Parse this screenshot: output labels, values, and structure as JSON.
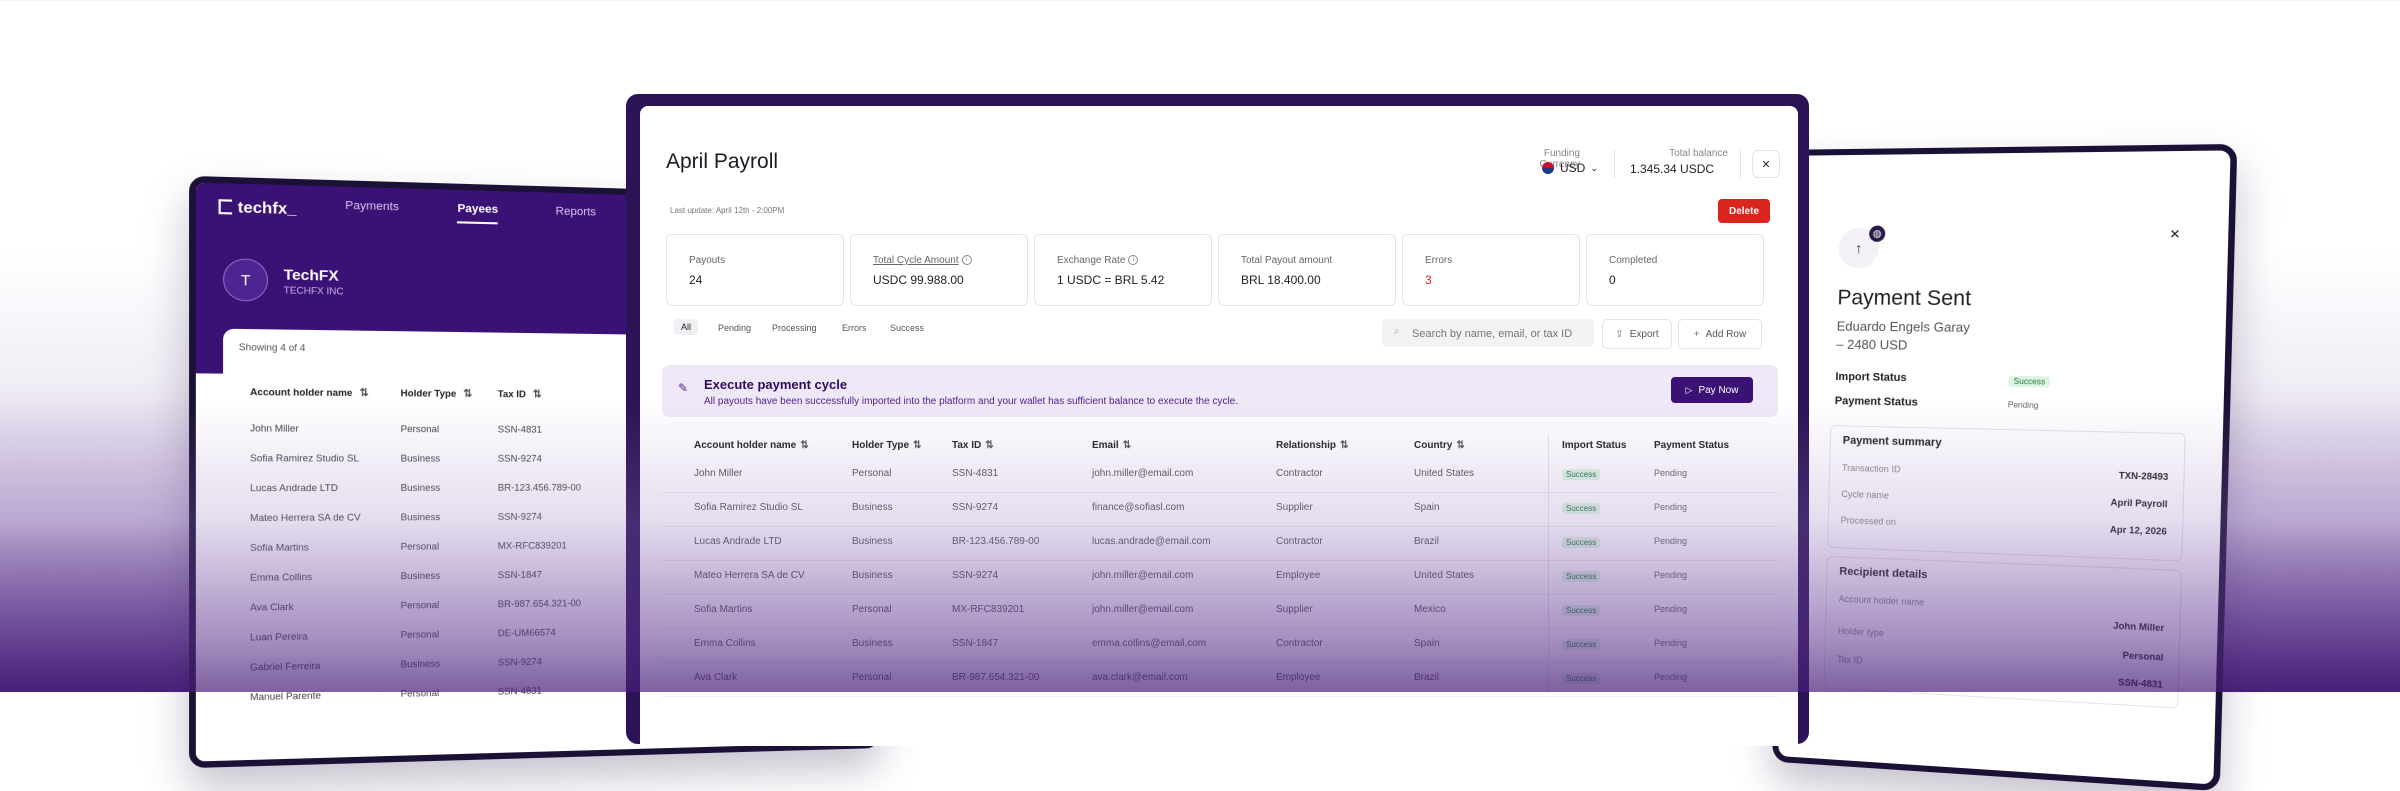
{
  "payees_window": {
    "brand": "techfx_",
    "nav": [
      "Payments",
      "Payees",
      "Reports"
    ],
    "org_initial": "T",
    "org_name": "TechFX",
    "org_sub": "TECHFX INC",
    "showing": "Showing 4 of 4",
    "columns": [
      "Account holder name",
      "Holder Type",
      "Tax ID"
    ],
    "rows": [
      [
        "John Miller",
        "Personal",
        "SSN-4831"
      ],
      [
        "Sofia Ramirez Studio SL",
        "Business",
        "SSN-9274"
      ],
      [
        "Lucas Andrade LTD",
        "Business",
        "BR-123.456.789-00"
      ],
      [
        "Mateo Herrera SA de CV",
        "Business",
        "SSN-9274"
      ],
      [
        "Sofia Martins",
        "Personal",
        "MX-RFC839201"
      ],
      [
        "Emma Collins",
        "Business",
        "SSN-1847"
      ],
      [
        "Ava Clark",
        "Personal",
        "BR-987.654.321-00"
      ],
      [
        "Luan Pereira",
        "Personal",
        "DE-UM66574"
      ],
      [
        "Gabriel Ferreira",
        "Business",
        "SSN-9274"
      ],
      [
        "Manuel Parente",
        "Personal",
        "SSN-4831"
      ]
    ]
  },
  "payment_sent": {
    "title": "Payment Sent",
    "payee": "Eduardo Engels Garay",
    "amount": "– 2480 USD",
    "import_status_label": "Import Status",
    "import_status": "Success",
    "payment_status_label": "Payment Status",
    "payment_status": "Pending",
    "summary_title": "Payment summary",
    "summary": [
      {
        "k": "Transaction ID",
        "v": "TXN-28493"
      },
      {
        "k": "Cycle name",
        "v": "April Payroll"
      },
      {
        "k": "Processed on",
        "v": "Apr 12, 2026"
      }
    ],
    "recipient_title": "Recipient details",
    "recipient": [
      {
        "k": "Account holder name",
        "v": "John Miller"
      },
      {
        "k": "Holder type",
        "v": "Personal"
      },
      {
        "k": "Tax ID",
        "v": "SSN-4831"
      }
    ]
  },
  "payroll": {
    "title": "April Payroll",
    "funding_currency_label": "Funding Currency",
    "funding_currency": "USD",
    "total_balance_label": "Total balance",
    "total_balance": "1.345.34 USDC",
    "last_update": "Last update: April 12th - 2:00PM",
    "delete_label": "Delete",
    "stats": [
      {
        "label": "Payouts",
        "value": "24"
      },
      {
        "label": "Total Cycle Amount",
        "value": "USDC 99.988.00"
      },
      {
        "label": "Exchange Rate",
        "value": "1 USDC = BRL 5.42"
      },
      {
        "label": "Total Payout amount",
        "value": "BRL 18.400.00"
      },
      {
        "label": "Errors",
        "value": "3"
      },
      {
        "label": "Completed",
        "value": "0"
      }
    ],
    "tabs": [
      "All",
      "Pending",
      "Processing",
      "Errors",
      "Success"
    ],
    "search_placeholder": "Search by name, email, or tax ID",
    "export_label": "Export",
    "add_row_label": "Add Row",
    "banner_title": "Execute payment cycle",
    "banner_text": "All payouts have been successfully imported into the platform and your wallet has sufficient balance to execute the cycle.",
    "pay_now_label": "Pay Now",
    "columns": [
      "Account holder name",
      "Holder Type",
      "Tax ID",
      "Email",
      "Relationship",
      "Country",
      "Import Status",
      "Payment Status"
    ],
    "rows": [
      [
        "John Miller",
        "Personal",
        "SSN-4831",
        "john.miller@email.com",
        "Contractor",
        "United States",
        "Success",
        "Pending"
      ],
      [
        "Sofia Ramirez Studio SL",
        "Business",
        "SSN-9274",
        "finance@sofiasl.com",
        "Supplier",
        "Spain",
        "Success",
        "Pending"
      ],
      [
        "Lucas Andrade LTD",
        "Business",
        "BR-123.456.789-00",
        "lucas.andrade@email.com",
        "Contractor",
        "Brazil",
        "Success",
        "Pending"
      ],
      [
        "Mateo Herrera SA de CV",
        "Business",
        "SSN-9274",
        "john.miller@email.com",
        "Employee",
        "United States",
        "Success",
        "Pending"
      ],
      [
        "Sofia Martins",
        "Personal",
        "MX-RFC839201",
        "john.miller@email.com",
        "Supplier",
        "Mexico",
        "Success",
        "Pending"
      ],
      [
        "Emma Collins",
        "Business",
        "SSN-1847",
        "emma.collins@email.com",
        "Contractor",
        "Spain",
        "Success",
        "Pending"
      ],
      [
        "Ava Clark",
        "Personal",
        "BR-987.654.321-00",
        "ava.clark@email.com",
        "Employee",
        "Brazil",
        "Success",
        "Pending"
      ]
    ]
  }
}
